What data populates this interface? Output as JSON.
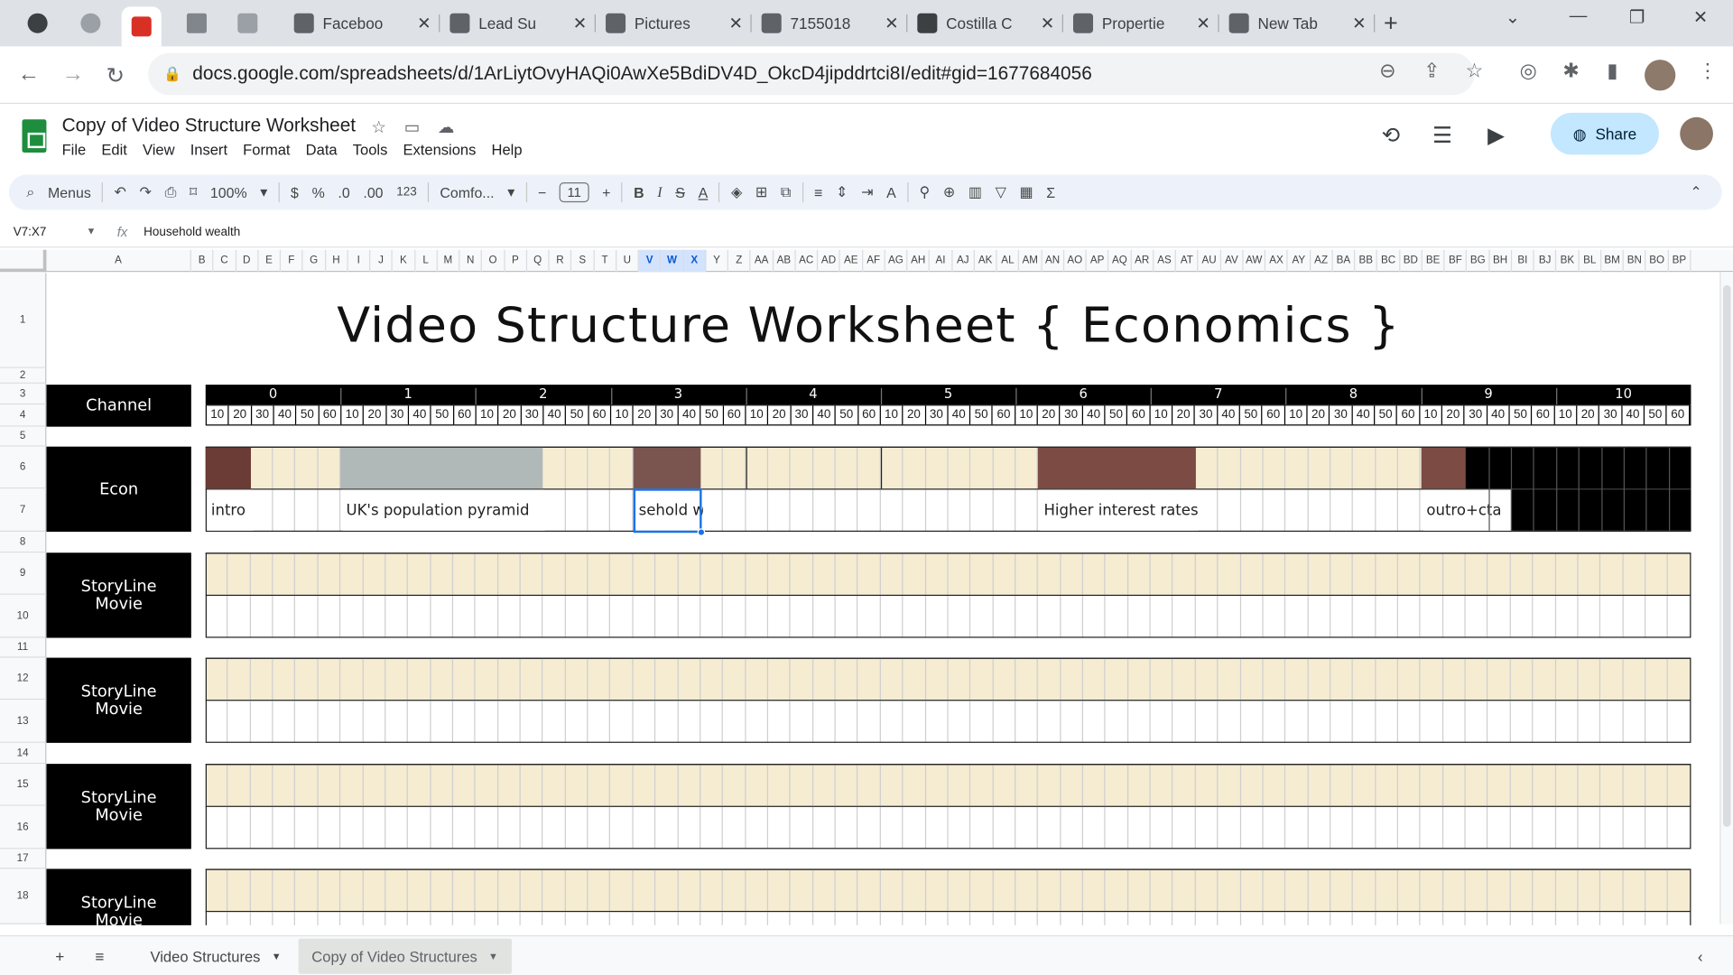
{
  "browser": {
    "tabs": [
      {
        "label": "Faceboo",
        "icon": "document-icon",
        "color": "#5f6368"
      },
      {
        "label": "Lead Su",
        "icon": "box-icon",
        "color": "#5f6368"
      },
      {
        "label": "Pictures",
        "icon": "drive-icon",
        "color": "#5f6368"
      },
      {
        "label": "7155018",
        "icon": "drive-icon",
        "color": "#5f6368"
      },
      {
        "label": "Costilla C",
        "icon": "sheets-icon",
        "color": "#3c4043"
      },
      {
        "label": "Propertie",
        "icon": "grid-icon",
        "color": "#5f6368"
      },
      {
        "label": "New Tab",
        "icon": "chrome-icon",
        "color": "#5f6368"
      }
    ],
    "new_tab_glyph": "+",
    "url": "docs.google.com/spreadsheets/d/1ArLiytOvyHAQi0AwXe5BdiDV4D_OkcD4jipddrtci8I/edit#gid=1677684056"
  },
  "doc": {
    "title": "Copy of Video Structure Worksheet",
    "menus": [
      "File",
      "Edit",
      "View",
      "Insert",
      "Format",
      "Data",
      "Tools",
      "Extensions",
      "Help"
    ],
    "share_label": "Share"
  },
  "toolbar": {
    "search_label": "Menus",
    "zoom": "100%",
    "currency": "$",
    "percent": "%",
    "dec_less": ".0",
    "dec_more": ".00",
    "format_123": "123",
    "font": "Comfo...",
    "font_size": "11",
    "bold": "B",
    "italic": "I"
  },
  "formula_bar": {
    "cell_ref": "V7:X7",
    "fx": "fx",
    "value": "Household wealth"
  },
  "grid": {
    "columns": [
      "A",
      "B",
      "C",
      "D",
      "E",
      "F",
      "G",
      "H",
      "I",
      "J",
      "K",
      "L",
      "M",
      "N",
      "O",
      "P",
      "Q",
      "R",
      "S",
      "T",
      "U",
      "V",
      "W",
      "X",
      "Y",
      "Z",
      "AA",
      "AB",
      "AC",
      "AD",
      "AE",
      "AF",
      "AG",
      "AH",
      "AI",
      "AJ",
      "AK",
      "AL",
      "AM",
      "AN",
      "AO",
      "AP",
      "AQ",
      "AR",
      "AS",
      "AT",
      "AU",
      "AV",
      "AW",
      "AX",
      "AY",
      "AZ",
      "BA",
      "BB",
      "BC",
      "BD",
      "BE",
      "BF",
      "BG",
      "BH",
      "BI",
      "BJ",
      "BK",
      "BL",
      "BM",
      "BN",
      "BO",
      "BP"
    ],
    "selected_columns": [
      "V",
      "W",
      "X"
    ],
    "rows": [
      "1",
      "2",
      "3",
      "4",
      "5",
      "6",
      "7",
      "8",
      "9",
      "10",
      "11",
      "12",
      "13",
      "14",
      "15",
      "16",
      "17",
      "18"
    ]
  },
  "sheet": {
    "title": "Video Structure Worksheet { Economics }",
    "channel_label": "Channel",
    "minutes": [
      "0",
      "1",
      "2",
      "3",
      "4",
      "5",
      "6",
      "7",
      "8",
      "9",
      "10"
    ],
    "seconds": [
      "10",
      "20",
      "30",
      "40",
      "50",
      "60"
    ],
    "econ_label": "Econ",
    "segments": [
      {
        "text": "intro",
        "color": "#6b3b35"
      },
      {
        "text": "UK's population pyramid",
        "color": "#b1b9b8"
      },
      {
        "text": "sehold w",
        "color": "#7a5550"
      },
      {
        "text": "Higher interest rates",
        "color": "#7b4b44"
      },
      {
        "text": "outro+cta",
        "color": "#7b4b44"
      }
    ],
    "storyline_label": "StoryLine Movie",
    "cream": "#f5ecd2"
  },
  "sheets_bar": {
    "add": "+",
    "list": "≡",
    "tabs": [
      "Video Structures",
      "Copy of Video Structures"
    ],
    "active_tab": 1
  }
}
